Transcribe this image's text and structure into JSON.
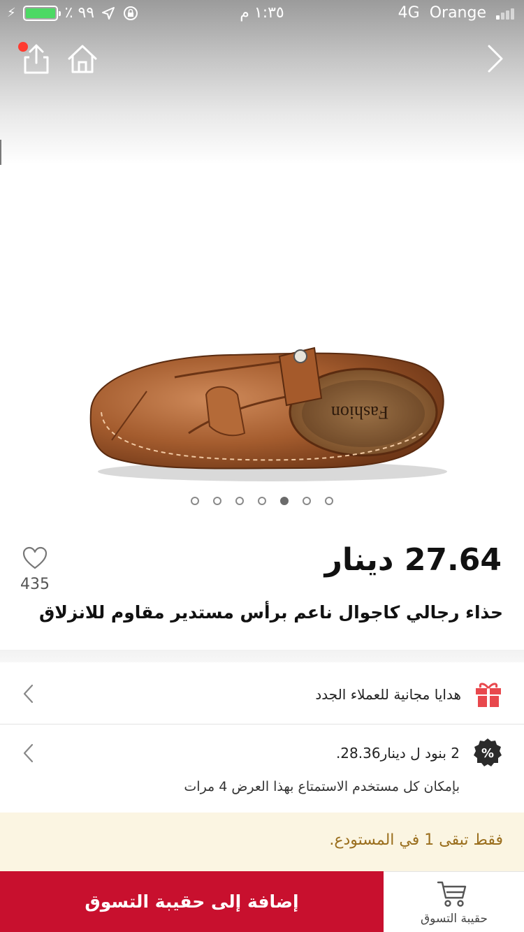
{
  "status_bar": {
    "battery_percent": "٪ ٩٩",
    "time": "١:٣٥ م",
    "network": "4G",
    "carrier": "Orange"
  },
  "icons": {
    "share": "share-icon",
    "home": "home-icon",
    "forward": "chevron-right-icon",
    "favorite": "heart-icon",
    "gift": "gift-icon",
    "discount": "percent-badge-icon",
    "bag": "shopping-bag-icon"
  },
  "carousel": {
    "total": 7,
    "active_index": 4
  },
  "product": {
    "price": "27.64 دينار",
    "favorites_count": "435",
    "title": "حذاء رجالي كاجوال ناعم برأس مستدير مقاوم للانزلاق"
  },
  "promos": {
    "gift_text": "هدايا مجانية للعملاء الجدد",
    "bundle_text": "2 بنود ل دينار28.36.",
    "bundle_note": "بإمكان كل مستخدم الاستمتاع بهذا العرض 4 مرات"
  },
  "stock_notice": "فقط تبقى 1 في المستودع.",
  "bottom_bar": {
    "add_to_bag": "إضافة إلى حقيبة التسوق",
    "bag_label": "حقيبة التسوق"
  },
  "colors": {
    "accent": "#c8102e",
    "battery": "#4cd964",
    "stock_bg": "#fbf5e2",
    "stock_text": "#9a6e1d",
    "gift_icon": "#e8484d"
  }
}
